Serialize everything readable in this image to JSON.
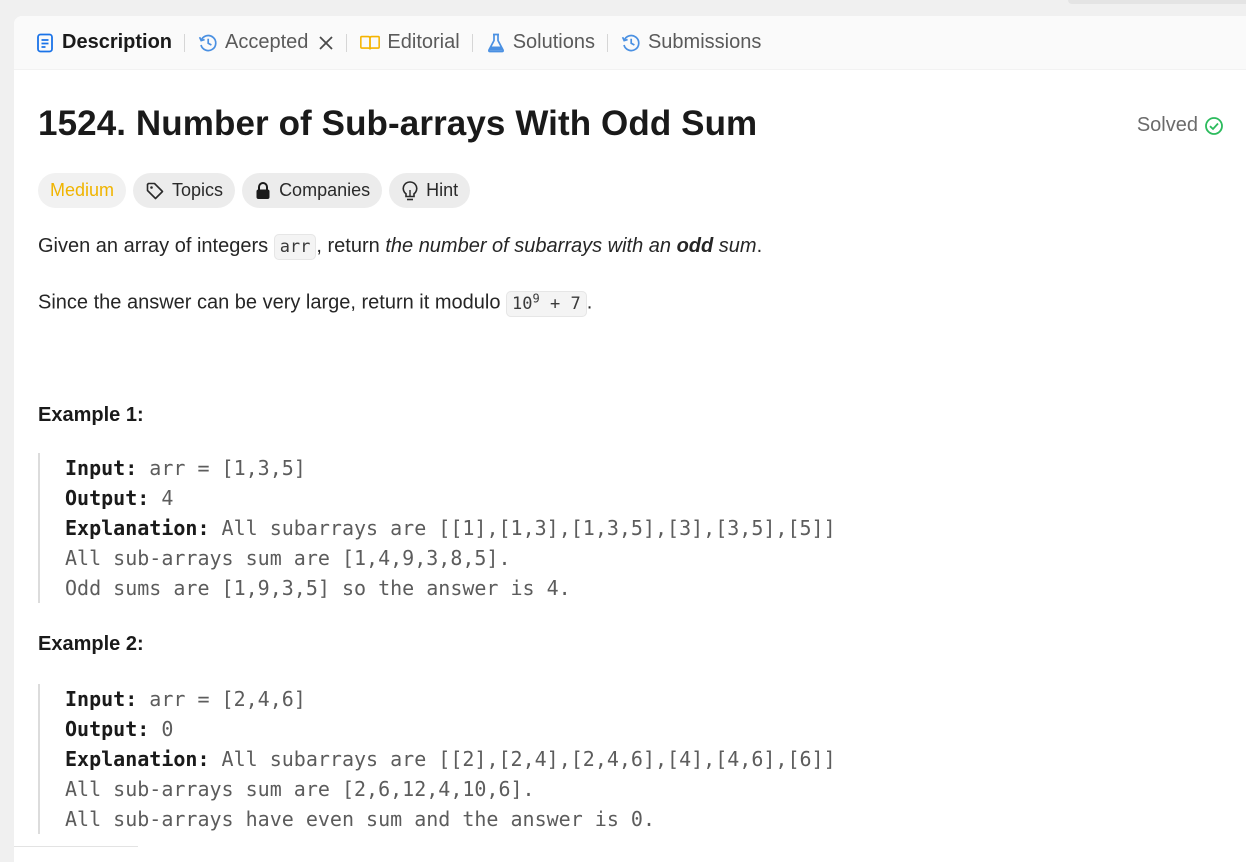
{
  "tabs": [
    {
      "label": "Description",
      "icon": "description-icon",
      "active": true
    },
    {
      "label": "Accepted",
      "icon": "history-icon",
      "closable": true
    },
    {
      "label": "Editorial",
      "icon": "book-icon"
    },
    {
      "label": "Solutions",
      "icon": "flask-icon"
    },
    {
      "label": "Submissions",
      "icon": "history-icon"
    }
  ],
  "problem": {
    "title": "1524. Number of Sub-arrays With Odd Sum",
    "status": "Solved",
    "difficulty": "Medium",
    "chips": {
      "topics": "Topics",
      "companies": "Companies",
      "hint": "Hint"
    }
  },
  "description": {
    "p1_prefix": "Given an array of integers ",
    "p1_code": "arr",
    "p1_mid": ", return ",
    "p1_italic": "the number of subarrays with an ",
    "p1_bold": "odd",
    "p1_suffix": " sum",
    "p1_end": ".",
    "p2_prefix": "Since the answer can be very large, return it modulo ",
    "p2_code_base": "10",
    "p2_code_exp": "9",
    "p2_code_rest": " + 7",
    "p2_end": "."
  },
  "examples": [
    {
      "title": "Example 1:",
      "input_label": "Input:",
      "input": " arr = [1,3,5]",
      "output_label": "Output:",
      "output": " 4",
      "explanation_label": "Explanation:",
      "explanation": " All subarrays are [[1],[1,3],[1,3,5],[3],[3,5],[5]]",
      "line4": "All sub-arrays sum are [1,4,9,3,8,5].",
      "line5": "Odd sums are [1,9,3,5] so the answer is 4."
    },
    {
      "title": "Example 2:",
      "input_label": "Input:",
      "input": " arr = [2,4,6]",
      "output_label": "Output:",
      "output": " 0",
      "explanation_label": "Explanation:",
      "explanation": " All subarrays are [[2],[2,4],[2,4,6],[4],[4,6],[6]]",
      "line4": "All sub-arrays sum are [2,6,12,4,10,6].",
      "line5": "All sub-arrays have even sum and the answer is 0."
    }
  ],
  "colors": {
    "accent": "#1a73e8",
    "medium": "#f0b400",
    "solved": "#2cbb5d",
    "editorial": "#f5b400"
  }
}
